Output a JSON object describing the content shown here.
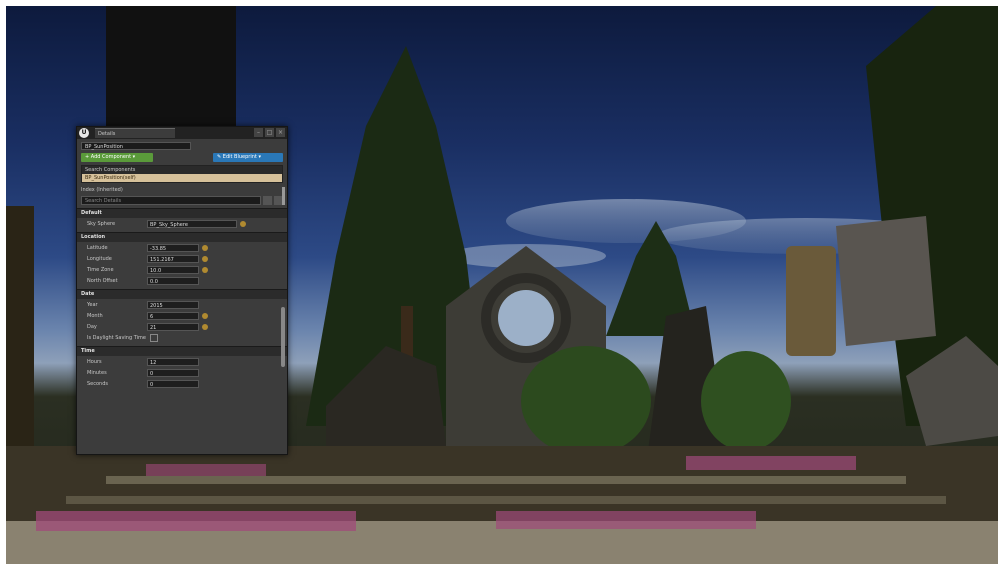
{
  "window": {
    "tab_label": "Details",
    "close_symbol": "×",
    "minimize_symbol": "–",
    "maximize_symbol": "□"
  },
  "actor": {
    "name": "BP_SunPosition"
  },
  "toolbar": {
    "add_component_label": "+ Add Component ▾",
    "edit_blueprint_label": "✎ Edit Blueprint ▾"
  },
  "components": {
    "items": [
      {
        "label": "Search Components"
      },
      {
        "label": "BP_SunPosition(self)"
      }
    ],
    "index_selected_label": "Index (Inherited)"
  },
  "details_search": {
    "placeholder": "Search Details"
  },
  "sections": {
    "default": {
      "title": "Default",
      "sky_sphere_label": "Sky Sphere",
      "sky_sphere_value": "BP_Sky_Sphere"
    },
    "location": {
      "title": "Location",
      "latitude_label": "Latitude",
      "latitude_value": "-33.85",
      "longitude_label": "Longitude",
      "longitude_value": "151.2167",
      "timezone_label": "Time Zone",
      "timezone_value": "10.0",
      "north_offset_label": "North Offset",
      "north_offset_value": "0.0"
    },
    "date": {
      "title": "Date",
      "year_label": "Year",
      "year_value": "2015",
      "month_label": "Month",
      "month_value": "6",
      "day_label": "Day",
      "day_value": "21",
      "dst_label": "Is Daylight Saving Time"
    },
    "time": {
      "title": "Time",
      "hours_label": "Hours",
      "hours_value": "12",
      "minutes_label": "Minutes",
      "minutes_value": "0",
      "seconds_label": "Seconds",
      "seconds_value": "0"
    }
  },
  "colors": {
    "panel_bg": "#3c3c3c",
    "accent_green": "#5a9a3a",
    "accent_blue": "#2a78b8",
    "selection": "#d6c19a"
  }
}
